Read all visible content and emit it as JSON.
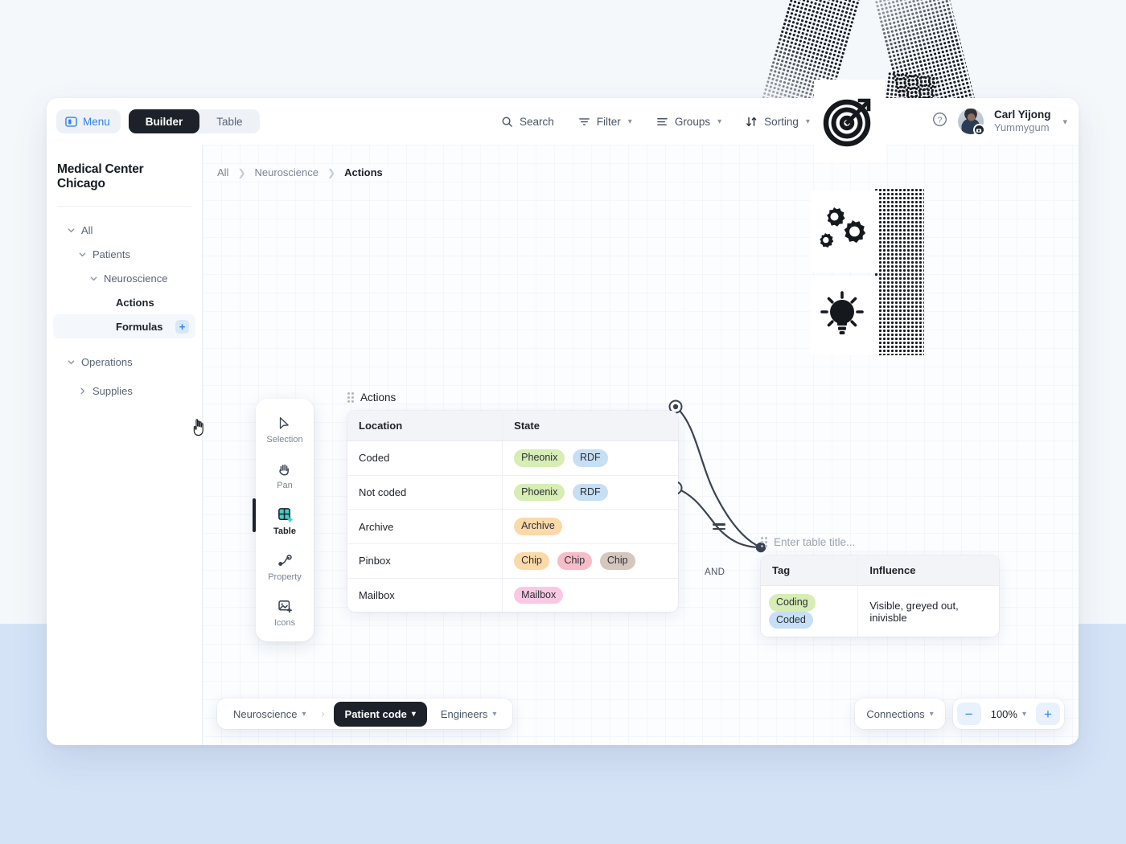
{
  "topbar": {
    "menu_label": "Menu",
    "menu_icon": "sidebar-panel-icon",
    "tabs": [
      {
        "label": "Builder",
        "active": true
      },
      {
        "label": "Table",
        "active": false
      }
    ],
    "tools": [
      {
        "label": "Search",
        "icon": "search-icon",
        "has_caret": false
      },
      {
        "label": "Filter",
        "icon": "filter-icon",
        "has_caret": true
      },
      {
        "label": "Groups",
        "icon": "groups-icon",
        "has_caret": true
      },
      {
        "label": "Sorting",
        "icon": "sorting-icon",
        "has_caret": true
      }
    ],
    "help_icon": "question-circle-icon",
    "user": {
      "name": "Carl Yijong",
      "org": "Yummygum",
      "avatar_icon": "avatar",
      "badge_icon": "camera-badge-icon",
      "caret": "chevron-down-icon"
    }
  },
  "sidebar": {
    "workspace_title": "Medical Center Chicago",
    "tree": [
      {
        "label": "All",
        "level": 0,
        "expanded": true,
        "leaf": false
      },
      {
        "label": "Patients",
        "level": 1,
        "expanded": true,
        "leaf": false
      },
      {
        "label": "Neuroscience",
        "level": 2,
        "expanded": true,
        "leaf": false
      },
      {
        "label": "Actions",
        "level": 3,
        "expanded": null,
        "leaf": true,
        "selected": true
      },
      {
        "label": "Formulas",
        "level": 3,
        "expanded": null,
        "leaf": true,
        "hovered": true,
        "add_label": "+"
      },
      {
        "label": "Operations",
        "level": 0,
        "expanded": true,
        "leaf": false
      },
      {
        "label": "Supplies",
        "level": 1,
        "expanded": false,
        "leaf": false
      }
    ]
  },
  "canvas": {
    "breadcrumb": [
      {
        "label": "All",
        "current": false
      },
      {
        "label": "Neuroscience",
        "current": false
      },
      {
        "label": "Actions",
        "current": true
      }
    ],
    "palette": [
      {
        "label": "Selection",
        "icon": "cursor-arrow-icon",
        "active": false
      },
      {
        "label": "Pan",
        "icon": "hand-icon",
        "active": false
      },
      {
        "label": "Table",
        "icon": "table-plus-icon",
        "active": true
      },
      {
        "label": "Property",
        "icon": "property-node-icon",
        "active": false
      },
      {
        "label": "Icons",
        "icon": "image-plus-icon",
        "active": false
      }
    ],
    "tables": [
      {
        "title": "Actions",
        "title_is_placeholder": false,
        "drag_handle_icon": "drag-dots-icon",
        "columns": [
          "Location",
          "State"
        ],
        "rows": [
          {
            "location": "Coded",
            "chips": [
              {
                "text": "Pheonix",
                "color": "green"
              },
              {
                "text": "RDF",
                "color": "blue"
              }
            ]
          },
          {
            "location": "Not coded",
            "chips": [
              {
                "text": "Phoenix",
                "color": "green"
              },
              {
                "text": "RDF",
                "color": "blue"
              }
            ]
          },
          {
            "location": "Archive",
            "chips": [
              {
                "text": "Archive",
                "color": "peach"
              }
            ]
          },
          {
            "location": "Pinbox",
            "chips": [
              {
                "text": "Chip",
                "color": "peach"
              },
              {
                "text": "Chip",
                "color": "pink"
              },
              {
                "text": "Chip",
                "color": "taupe"
              }
            ]
          },
          {
            "location": "Mailbox",
            "chips": [
              {
                "text": "Mailbox",
                "color": "magenta"
              }
            ]
          }
        ]
      },
      {
        "title": "Enter table title...",
        "title_is_placeholder": true,
        "drag_handle_icon": "drag-dots-icon",
        "columns": [
          "Tag",
          "Influence"
        ],
        "rows": [
          {
            "chips": [
              {
                "text": "Coding",
                "color": "green"
              },
              {
                "text": "Coded",
                "color": "blue"
              }
            ],
            "influence": "Visible, greyed out, inivisble"
          }
        ]
      }
    ],
    "connectors": [
      {
        "label": "=",
        "type": "equals-badge"
      },
      {
        "label": "AND",
        "type": "and-label"
      }
    ]
  },
  "bottom_bar": {
    "left": [
      {
        "label": "Neuroscience",
        "style": "plain",
        "caret": "chevron-down-icon"
      },
      {
        "label": "Patient code",
        "style": "dark",
        "caret": "chevron-down-icon"
      },
      {
        "label": "Engineers",
        "style": "plain",
        "caret": "chevron-down-icon"
      }
    ],
    "separator": "›",
    "connections_label": "Connections",
    "connections_caret": "chevron-down-icon",
    "zoom_out_label": "−",
    "zoom_level": "100%",
    "zoom_caret": "chevron-down-icon",
    "zoom_in_label": "+"
  },
  "decor": {
    "target_icon": "target-dartboard-icon",
    "gears_icon": "gears-icon",
    "bulb_icon": "lightbulb-icon",
    "cursor_icon": "hand-cursor-icon"
  },
  "colors": {
    "accent_blue": "#2f7ff0",
    "dark": "#1d2129",
    "canvas": "#fbfdff",
    "page_top": "#f5f8fb",
    "page_bottom": "#d5e3f7",
    "chip_green": "#d6edb4",
    "chip_blue": "#c7dff4",
    "chip_peach": "#fbd9a8",
    "chip_pink": "#f6bdc8",
    "chip_taupe": "#d5c7bc",
    "chip_magenta": "#fbc8e4"
  }
}
